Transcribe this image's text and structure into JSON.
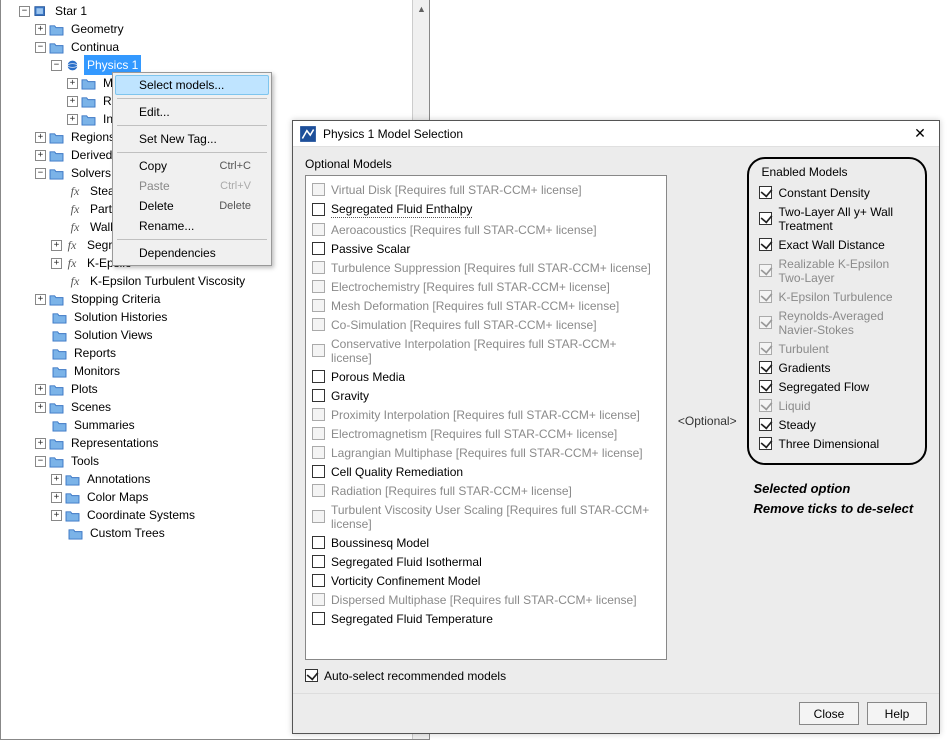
{
  "tree": {
    "root": "Star 1",
    "items": {
      "geometry": "Geometry",
      "continua": "Continua",
      "physics": "Physics 1",
      "mod": "Mod",
      "ref": "Refe",
      "init": "Initia",
      "regions": "Regions",
      "derived": "Derived Parts",
      "solvers": "Solvers",
      "steady": "Steady",
      "partition": "Partition",
      "walldist": "Wall Dist",
      "segrega": "Segrega",
      "kepsilo": "K-Epsilo",
      "kepsilonvisc": "K-Epsilon Turbulent Viscosity",
      "stopping": "Stopping Criteria",
      "solhist": "Solution Histories",
      "solviews": "Solution Views",
      "reports": "Reports",
      "monitors": "Monitors",
      "plots": "Plots",
      "scenes": "Scenes",
      "summaries": "Summaries",
      "represent": "Representations",
      "tools": "Tools",
      "annotations": "Annotations",
      "colormaps": "Color Maps",
      "coordsys": "Coordinate Systems",
      "customtrees": "Custom Trees"
    }
  },
  "context": {
    "select_models": "Select models...",
    "edit": "Edit...",
    "set_new_tag": "Set New Tag...",
    "copy": "Copy",
    "copy_sc": "Ctrl+C",
    "paste": "Paste",
    "paste_sc": "Ctrl+V",
    "delete": "Delete",
    "delete_sc": "Delete",
    "rename": "Rename...",
    "dependencies": "Dependencies"
  },
  "dialog": {
    "title": "Physics 1 Model Selection",
    "optional_title": "Optional Models",
    "middle_label": "<Optional>",
    "enabled_title": "Enabled Models",
    "auto_select": "Auto-select recommended models",
    "close": "Close",
    "help": "Help",
    "annotation1": "Selected option",
    "annotation2": "Remove ticks to de-select",
    "optional": [
      {
        "label": "Virtual Disk",
        "req": "[Requires full STAR-CCM+ license]",
        "disabled": true,
        "checked": false
      },
      {
        "label": "Segregated Fluid Enthalpy",
        "req": "",
        "disabled": false,
        "checked": false,
        "dotted": true
      },
      {
        "label": "Aeroacoustics",
        "req": "[Requires full STAR-CCM+ license]",
        "disabled": true,
        "checked": false
      },
      {
        "label": "Passive Scalar",
        "req": "",
        "disabled": false,
        "checked": false
      },
      {
        "label": "Turbulence Suppression",
        "req": "[Requires full STAR-CCM+ license]",
        "disabled": true,
        "checked": false
      },
      {
        "label": "Electrochemistry",
        "req": "[Requires full STAR-CCM+ license]",
        "disabled": true,
        "checked": false
      },
      {
        "label": "Mesh Deformation",
        "req": "[Requires full STAR-CCM+ license]",
        "disabled": true,
        "checked": false
      },
      {
        "label": "Co-Simulation",
        "req": "[Requires full STAR-CCM+ license]",
        "disabled": true,
        "checked": false
      },
      {
        "label": "Conservative Interpolation",
        "req": "[Requires full STAR-CCM+ license]",
        "disabled": true,
        "checked": false
      },
      {
        "label": "Porous Media",
        "req": "",
        "disabled": false,
        "checked": false
      },
      {
        "label": "Gravity",
        "req": "",
        "disabled": false,
        "checked": false
      },
      {
        "label": "Proximity Interpolation",
        "req": "[Requires full STAR-CCM+ license]",
        "disabled": true,
        "checked": false
      },
      {
        "label": "Electromagnetism",
        "req": "[Requires full STAR-CCM+ license]",
        "disabled": true,
        "checked": false
      },
      {
        "label": "Lagrangian Multiphase",
        "req": "[Requires full STAR-CCM+ license]",
        "disabled": true,
        "checked": false
      },
      {
        "label": "Cell Quality Remediation",
        "req": "",
        "disabled": false,
        "checked": false
      },
      {
        "label": "Radiation",
        "req": "[Requires full STAR-CCM+ license]",
        "disabled": true,
        "checked": false
      },
      {
        "label": "Turbulent Viscosity User Scaling",
        "req": "[Requires full STAR-CCM+ license]",
        "disabled": true,
        "checked": false
      },
      {
        "label": "Boussinesq Model",
        "req": "",
        "disabled": false,
        "checked": false
      },
      {
        "label": "Segregated Fluid Isothermal",
        "req": "",
        "disabled": false,
        "checked": false
      },
      {
        "label": "Vorticity Confinement Model",
        "req": "",
        "disabled": false,
        "checked": false
      },
      {
        "label": "Dispersed Multiphase",
        "req": "[Requires full STAR-CCM+ license]",
        "disabled": true,
        "checked": false
      },
      {
        "label": "Segregated Fluid Temperature",
        "req": "",
        "disabled": false,
        "checked": false
      }
    ],
    "enabled": [
      {
        "label": "Constant Density",
        "disabled": false,
        "checked": true
      },
      {
        "label": "Two-Layer All y+ Wall Treatment",
        "disabled": false,
        "checked": true
      },
      {
        "label": "Exact Wall Distance",
        "disabled": false,
        "checked": true
      },
      {
        "label": "Realizable K-Epsilon Two-Layer",
        "disabled": true,
        "checked": true
      },
      {
        "label": "K-Epsilon Turbulence",
        "disabled": true,
        "checked": true
      },
      {
        "label": "Reynolds-Averaged Navier-Stokes",
        "disabled": true,
        "checked": true
      },
      {
        "label": "Turbulent",
        "disabled": true,
        "checked": true
      },
      {
        "label": "Gradients",
        "disabled": false,
        "checked": true
      },
      {
        "label": "Segregated Flow",
        "disabled": false,
        "checked": true
      },
      {
        "label": "Liquid",
        "disabled": true,
        "checked": true
      },
      {
        "label": "Steady",
        "disabled": false,
        "checked": true
      },
      {
        "label": "Three Dimensional",
        "disabled": false,
        "checked": true
      }
    ]
  }
}
